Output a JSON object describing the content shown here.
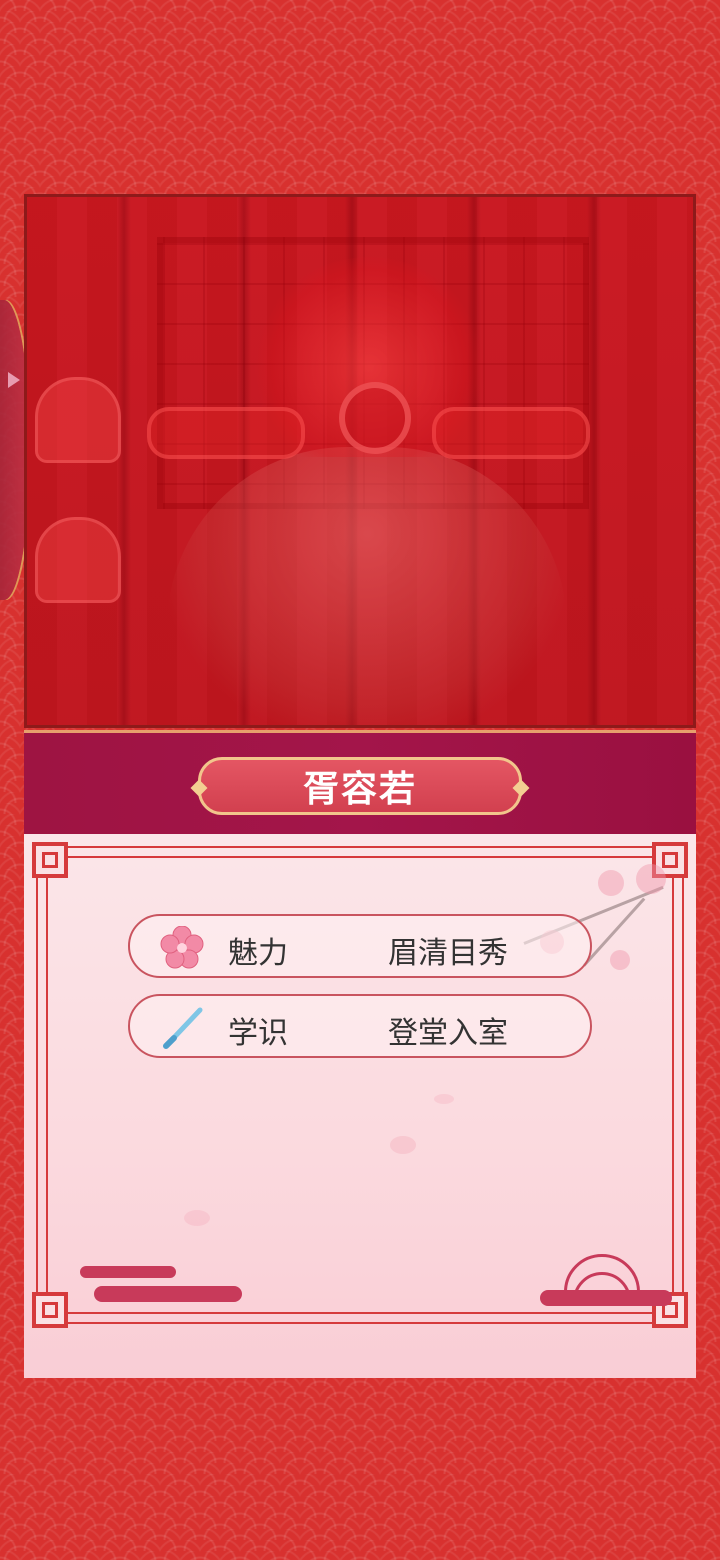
{
  "character": {
    "name": "胥容若"
  },
  "stats": [
    {
      "icon": "plum-blossom-icon",
      "label": "魅力",
      "value": "眉清目秀"
    },
    {
      "icon": "brush-icon",
      "label": "学识",
      "value": "登堂入室"
    }
  ],
  "colors": {
    "background": "#d8312f",
    "title_band": "#a3154a",
    "plaque": "#d94a58",
    "card": "#fbdde2",
    "frame": "#d63a3c"
  }
}
